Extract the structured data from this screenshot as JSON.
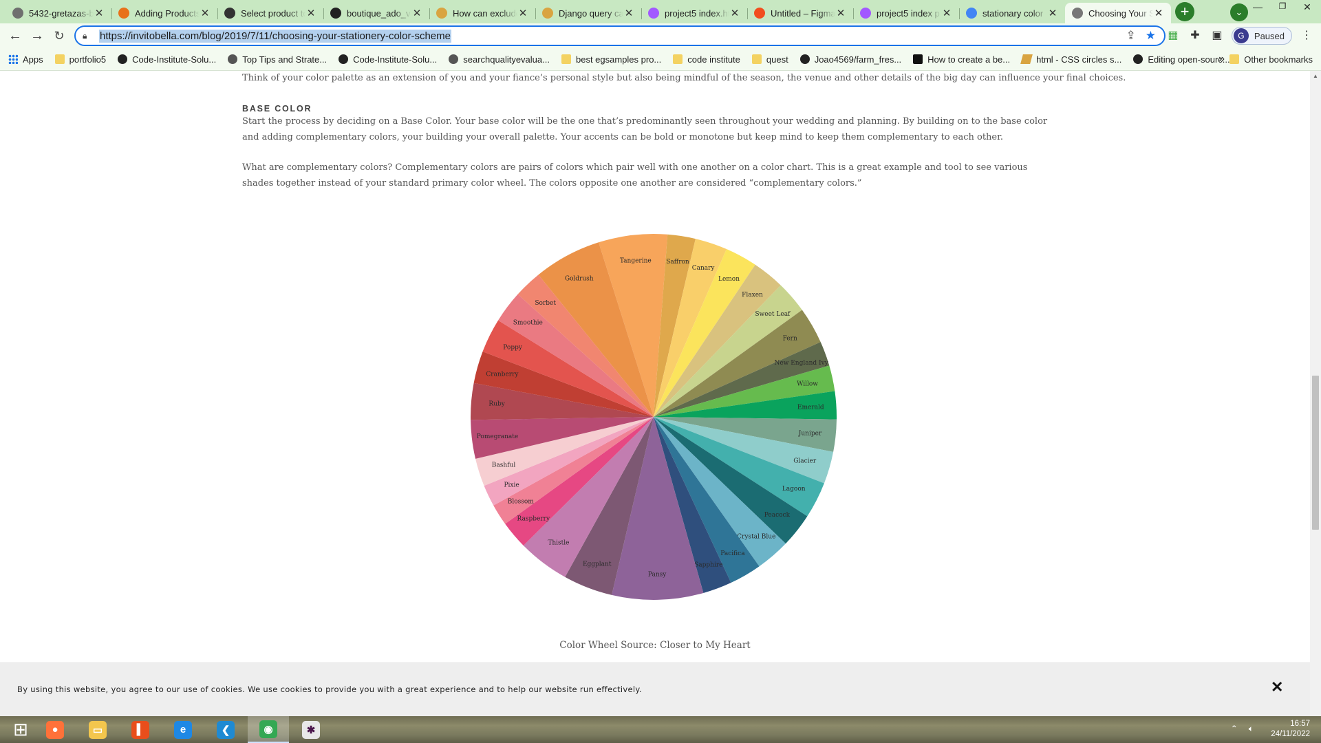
{
  "browser": {
    "tabs": [
      {
        "title": "5432-gretazas-b",
        "favicon_color": "#6f6f6f",
        "active": false
      },
      {
        "title": "Adding Products",
        "favicon_color": "#e8711a",
        "active": false
      },
      {
        "title": "Select product to",
        "favicon_color": "#333333",
        "active": false
      },
      {
        "title": "boutique_ado_v",
        "favicon_color": "#222222",
        "active": false
      },
      {
        "title": "How can exclude",
        "favicon_color": "#d9a441",
        "active": false
      },
      {
        "title": "Django query ca",
        "favicon_color": "#d9a441",
        "active": false
      },
      {
        "title": "project5 index.ht",
        "favicon_color": "#a259ff",
        "active": false
      },
      {
        "title": "Untitled – Figma",
        "favicon_color": "#f24e1e",
        "active": false
      },
      {
        "title": "project5 index p",
        "favicon_color": "#a259ff",
        "active": false
      },
      {
        "title": "stationary color",
        "favicon_color": "#4285f4",
        "active": false
      },
      {
        "title": "Choosing Your S",
        "favicon_color": "#777777",
        "active": true
      }
    ],
    "new_tab": "+",
    "tab_close": "✕",
    "url": "https://invitobella.com/blog/2019/7/11/choosing-your-stationery-color-scheme",
    "profile_initial": "G",
    "profile_status": "Paused",
    "accent_color": "#1a73e8",
    "window_controls": {
      "minimize": "—",
      "restore": "❐",
      "close": "✕"
    },
    "bookmarks": [
      {
        "label": "Apps",
        "icon": "apps-icon"
      },
      {
        "label": "portfolio5",
        "icon": "folder-icon"
      },
      {
        "label": "Code-Institute-Solu...",
        "icon": "github-icon"
      },
      {
        "label": "Top Tips and Strate...",
        "icon": "site-icon"
      },
      {
        "label": "Code-Institute-Solu...",
        "icon": "github-icon"
      },
      {
        "label": "searchqualityevalua...",
        "icon": "site-icon"
      },
      {
        "label": "best egsamples pro...",
        "icon": "folder-icon"
      },
      {
        "label": "code institute",
        "icon": "folder-icon"
      },
      {
        "label": "quest",
        "icon": "folder-icon"
      },
      {
        "label": "Joao4569/farm_fres...",
        "icon": "github-icon"
      },
      {
        "label": "How to create a be...",
        "icon": "medium-icon"
      },
      {
        "label": "html - CSS circles s...",
        "icon": "stackoverflow-icon"
      },
      {
        "label": "Editing open-sourc...",
        "icon": "github-icon"
      }
    ],
    "bookmarks_more": "»",
    "other_bookmarks": "Other bookmarks"
  },
  "article": {
    "intro_paragraph": "Think of your color palette as an extension of you and your fiance’s personal style but also being mindful of the season, the venue and other details of the big day can influence your final choices.",
    "section_heading": "BASE COLOR",
    "base_color_paragraph": "Start the process by deciding on a Base Color.  Your base color will be the one that’s predominantly seen throughout your wedding and planning.  By building on to the base color and adding complementary colors, your building your overall palette.  Your accents can be bold or monotone but keep mind to keep them complementary to each other.",
    "complementary_paragraph": "What are complementary colors?  Complementary colors are pairs of colors which pair well with one another on a color chart.  This is a great example and tool to see various shades together instead of your standard primary color wheel.  The colors opposite one another are considered “complementary colors.”",
    "image_caption": "Color Wheel Source: Closer to My Heart"
  },
  "color_wheel": {
    "segments": [
      {
        "name": "Tangerine",
        "color": "#f7a55a",
        "share": 6.4
      },
      {
        "name": "Saffron",
        "color": "#dfa84c",
        "share": 2.6
      },
      {
        "name": "Canary",
        "color": "#f9cf6a",
        "share": 3.0
      },
      {
        "name": "Lemon",
        "color": "#fbe45c",
        "share": 3.0
      },
      {
        "name": "Flaxen",
        "color": "#d9c27e",
        "share": 3.0
      },
      {
        "name": "Sweet Leaf",
        "color": "#c8d48e",
        "share": 3.0
      },
      {
        "name": "Fern",
        "color": "#8f8b52",
        "share": 3.4
      },
      {
        "name": "New England Ivy",
        "color": "#5f6a4c",
        "share": 2.3
      },
      {
        "name": "Willow",
        "color": "#66bb4e",
        "share": 2.4
      },
      {
        "name": "Emerald",
        "color": "#0aa35d",
        "share": 2.6
      },
      {
        "name": "Juniper",
        "color": "#7aa58e",
        "share": 3.0
      },
      {
        "name": "Glacier",
        "color": "#8fcdcb",
        "share": 3.0
      },
      {
        "name": "Lagoon",
        "color": "#43b0ad",
        "share": 3.4
      },
      {
        "name": "Peacock",
        "color": "#1b6c72",
        "share": 3.2
      },
      {
        "name": "Crystal Blue",
        "color": "#6cb4c8",
        "share": 3.2
      },
      {
        "name": "Pacifica",
        "color": "#2f7597",
        "share": 3.0
      },
      {
        "name": "Sapphire",
        "color": "#2f4f7d",
        "share": 2.7
      },
      {
        "name": "Pansy",
        "color": "#8e6399",
        "share": 8.5
      },
      {
        "name": "Eggplant",
        "color": "#7d5873",
        "share": 4.6
      },
      {
        "name": "Thistle",
        "color": "#c27db0",
        "share": 4.8
      },
      {
        "name": "Raspberry",
        "color": "#e64883",
        "share": 2.6
      },
      {
        "name": "Blossom",
        "color": "#f08195",
        "share": 2.0
      },
      {
        "name": "Pixie",
        "color": "#f2a5c0",
        "share": 2.0
      },
      {
        "name": "Bashful",
        "color": "#f6ced1",
        "share": 2.6
      },
      {
        "name": "Pomegranate",
        "color": "#b84b73",
        "share": 3.6
      },
      {
        "name": "Ruby",
        "color": "#b04851",
        "share": 3.4
      },
      {
        "name": "Cranberry",
        "color": "#c03f33",
        "share": 3.0
      },
      {
        "name": "Poppy",
        "color": "#e3544e",
        "share": 3.2
      },
      {
        "name": "Smoothie",
        "color": "#ea7a82",
        "share": 3.0
      },
      {
        "name": "Sorbet",
        "color": "#f18670",
        "share": 2.6
      },
      {
        "name": "Goldrush",
        "color": "#eb9248",
        "share": 6.3
      }
    ]
  },
  "cookie_banner": {
    "text": "By using this website, you agree to our use of cookies. We use cookies to provide you with a great experience and to help our website run effectively.",
    "close": "✕"
  },
  "taskbar": {
    "apps": [
      {
        "name": "windows-start-icon",
        "glyph": "⊞",
        "color": "transparent"
      },
      {
        "name": "firefox-icon",
        "glyph": "●",
        "color": "#ff7139"
      },
      {
        "name": "file-explorer-icon",
        "glyph": "▭",
        "color": "#f3c64d"
      },
      {
        "name": "office-icon",
        "glyph": "▌",
        "color": "#e94e1b"
      },
      {
        "name": "internet-explorer-icon",
        "glyph": "e",
        "color": "#1e88e5"
      },
      {
        "name": "vscode-icon",
        "glyph": "❮",
        "color": "#1f8ad2"
      },
      {
        "name": "chrome-icon",
        "glyph": "◉",
        "color": "#34a853"
      },
      {
        "name": "slack-icon",
        "glyph": "✱",
        "color": "#e8e8e8"
      }
    ],
    "time": "16:57",
    "date": "24/11/2022"
  }
}
